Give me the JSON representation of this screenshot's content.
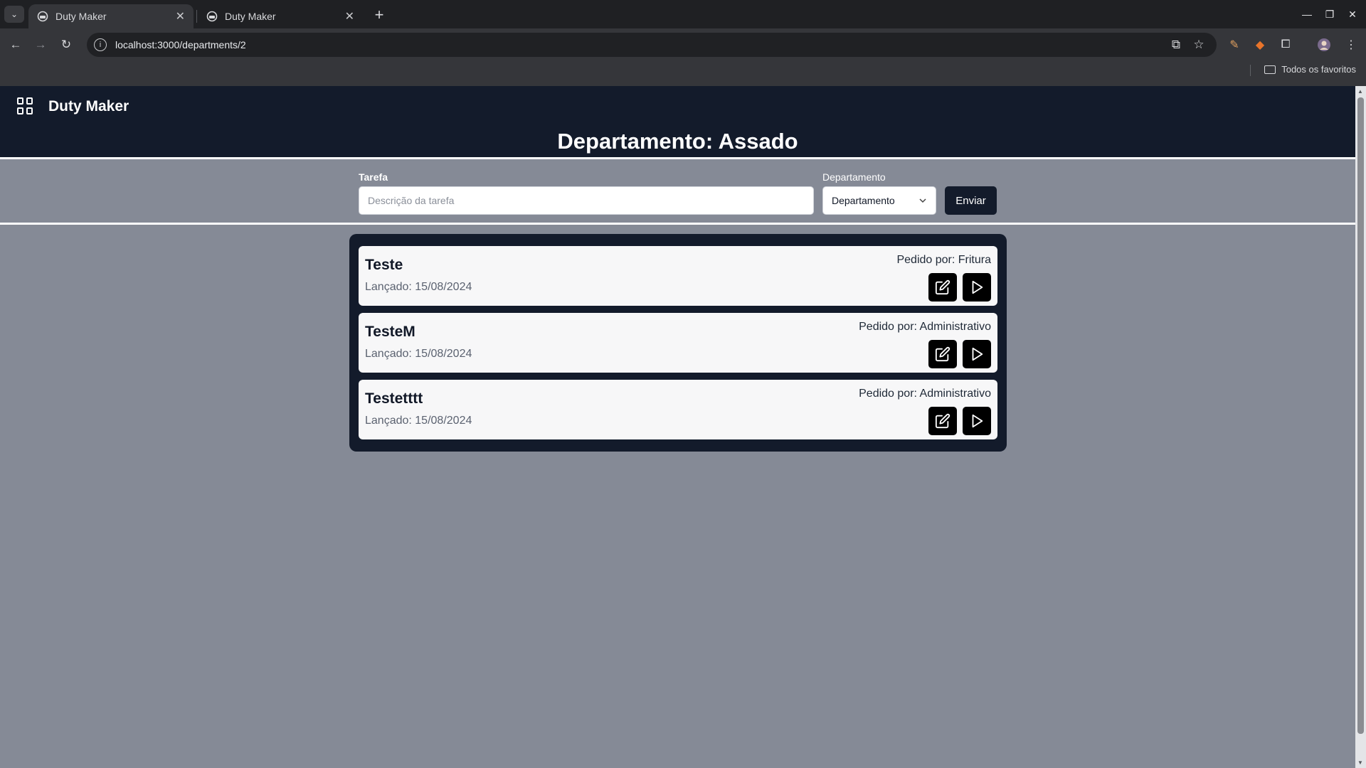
{
  "browser": {
    "tabs": [
      {
        "title": "Duty Maker",
        "active": true
      },
      {
        "title": "Duty Maker",
        "active": false
      }
    ],
    "url": "localhost:3000/departments/2",
    "bookmarks_label": "Todos os favoritos"
  },
  "app": {
    "brand": "Duty Maker",
    "page_title": "Departamento: Assado",
    "form": {
      "task_label": "Tarefa",
      "task_placeholder": "Descrição da tarefa",
      "dept_label": "Departamento",
      "dept_selected": "Departamento",
      "submit_label": "Enviar"
    },
    "tasks": [
      {
        "name": "Teste",
        "date": "Lançado: 15/08/2024",
        "requested_by": "Pedido por: Fritura"
      },
      {
        "name": "TesteM",
        "date": "Lançado: 15/08/2024",
        "requested_by": "Pedido por: Administrativo"
      },
      {
        "name": "Testetttt",
        "date": "Lançado: 15/08/2024",
        "requested_by": "Pedido por: Administrativo"
      }
    ]
  },
  "colors": {
    "header_bg": "#131b2b",
    "page_bg": "#858a96",
    "card_bg": "#f7f7f8",
    "action_button_bg": "#000000"
  },
  "icons": [
    "tab-search-icon",
    "favicon-icon",
    "close-icon",
    "new-tab-icon",
    "minimize-icon",
    "restore-icon",
    "window-close-icon",
    "back-icon",
    "forward-icon",
    "reload-icon",
    "site-info-icon",
    "open-external-icon",
    "bookmark-star-icon",
    "extension-icon",
    "puzzle-icon",
    "profile-avatar",
    "more-menu-icon",
    "folder-icon",
    "apps-grid-icon",
    "chevron-down-icon",
    "edit-icon",
    "play-icon"
  ]
}
